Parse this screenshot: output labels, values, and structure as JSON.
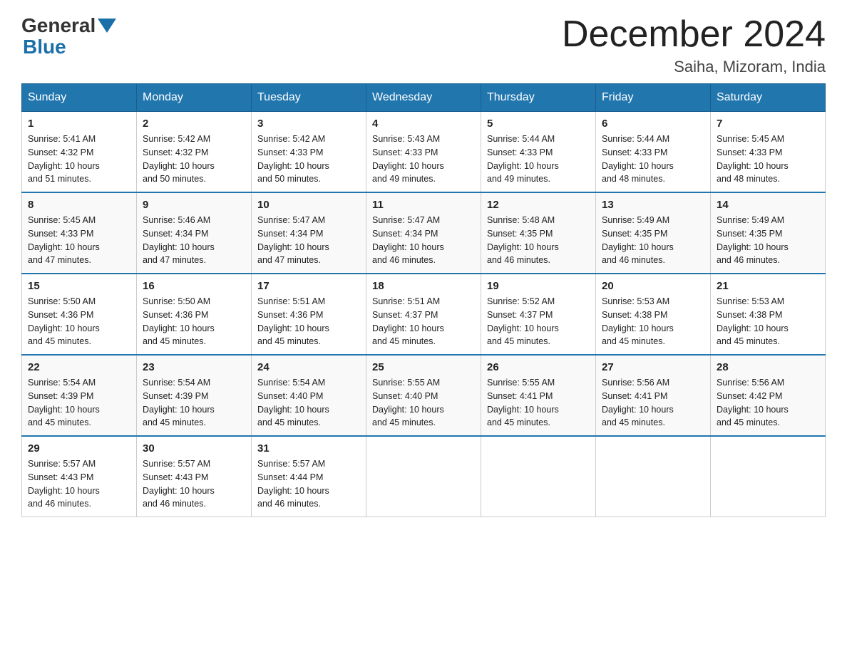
{
  "logo": {
    "text_general": "General",
    "text_blue": "Blue"
  },
  "title": {
    "month_year": "December 2024",
    "location": "Saiha, Mizoram, India"
  },
  "weekdays": [
    "Sunday",
    "Monday",
    "Tuesday",
    "Wednesday",
    "Thursday",
    "Friday",
    "Saturday"
  ],
  "weeks": [
    [
      {
        "day": 1,
        "sunrise": "5:41 AM",
        "sunset": "4:32 PM",
        "daylight": "10 hours and 51 minutes."
      },
      {
        "day": 2,
        "sunrise": "5:42 AM",
        "sunset": "4:32 PM",
        "daylight": "10 hours and 50 minutes."
      },
      {
        "day": 3,
        "sunrise": "5:42 AM",
        "sunset": "4:33 PM",
        "daylight": "10 hours and 50 minutes."
      },
      {
        "day": 4,
        "sunrise": "5:43 AM",
        "sunset": "4:33 PM",
        "daylight": "10 hours and 49 minutes."
      },
      {
        "day": 5,
        "sunrise": "5:44 AM",
        "sunset": "4:33 PM",
        "daylight": "10 hours and 49 minutes."
      },
      {
        "day": 6,
        "sunrise": "5:44 AM",
        "sunset": "4:33 PM",
        "daylight": "10 hours and 48 minutes."
      },
      {
        "day": 7,
        "sunrise": "5:45 AM",
        "sunset": "4:33 PM",
        "daylight": "10 hours and 48 minutes."
      }
    ],
    [
      {
        "day": 8,
        "sunrise": "5:45 AM",
        "sunset": "4:33 PM",
        "daylight": "10 hours and 47 minutes."
      },
      {
        "day": 9,
        "sunrise": "5:46 AM",
        "sunset": "4:34 PM",
        "daylight": "10 hours and 47 minutes."
      },
      {
        "day": 10,
        "sunrise": "5:47 AM",
        "sunset": "4:34 PM",
        "daylight": "10 hours and 47 minutes."
      },
      {
        "day": 11,
        "sunrise": "5:47 AM",
        "sunset": "4:34 PM",
        "daylight": "10 hours and 46 minutes."
      },
      {
        "day": 12,
        "sunrise": "5:48 AM",
        "sunset": "4:35 PM",
        "daylight": "10 hours and 46 minutes."
      },
      {
        "day": 13,
        "sunrise": "5:49 AM",
        "sunset": "4:35 PM",
        "daylight": "10 hours and 46 minutes."
      },
      {
        "day": 14,
        "sunrise": "5:49 AM",
        "sunset": "4:35 PM",
        "daylight": "10 hours and 46 minutes."
      }
    ],
    [
      {
        "day": 15,
        "sunrise": "5:50 AM",
        "sunset": "4:36 PM",
        "daylight": "10 hours and 45 minutes."
      },
      {
        "day": 16,
        "sunrise": "5:50 AM",
        "sunset": "4:36 PM",
        "daylight": "10 hours and 45 minutes."
      },
      {
        "day": 17,
        "sunrise": "5:51 AM",
        "sunset": "4:36 PM",
        "daylight": "10 hours and 45 minutes."
      },
      {
        "day": 18,
        "sunrise": "5:51 AM",
        "sunset": "4:37 PM",
        "daylight": "10 hours and 45 minutes."
      },
      {
        "day": 19,
        "sunrise": "5:52 AM",
        "sunset": "4:37 PM",
        "daylight": "10 hours and 45 minutes."
      },
      {
        "day": 20,
        "sunrise": "5:53 AM",
        "sunset": "4:38 PM",
        "daylight": "10 hours and 45 minutes."
      },
      {
        "day": 21,
        "sunrise": "5:53 AM",
        "sunset": "4:38 PM",
        "daylight": "10 hours and 45 minutes."
      }
    ],
    [
      {
        "day": 22,
        "sunrise": "5:54 AM",
        "sunset": "4:39 PM",
        "daylight": "10 hours and 45 minutes."
      },
      {
        "day": 23,
        "sunrise": "5:54 AM",
        "sunset": "4:39 PM",
        "daylight": "10 hours and 45 minutes."
      },
      {
        "day": 24,
        "sunrise": "5:54 AM",
        "sunset": "4:40 PM",
        "daylight": "10 hours and 45 minutes."
      },
      {
        "day": 25,
        "sunrise": "5:55 AM",
        "sunset": "4:40 PM",
        "daylight": "10 hours and 45 minutes."
      },
      {
        "day": 26,
        "sunrise": "5:55 AM",
        "sunset": "4:41 PM",
        "daylight": "10 hours and 45 minutes."
      },
      {
        "day": 27,
        "sunrise": "5:56 AM",
        "sunset": "4:41 PM",
        "daylight": "10 hours and 45 minutes."
      },
      {
        "day": 28,
        "sunrise": "5:56 AM",
        "sunset": "4:42 PM",
        "daylight": "10 hours and 45 minutes."
      }
    ],
    [
      {
        "day": 29,
        "sunrise": "5:57 AM",
        "sunset": "4:43 PM",
        "daylight": "10 hours and 46 minutes."
      },
      {
        "day": 30,
        "sunrise": "5:57 AM",
        "sunset": "4:43 PM",
        "daylight": "10 hours and 46 minutes."
      },
      {
        "day": 31,
        "sunrise": "5:57 AM",
        "sunset": "4:44 PM",
        "daylight": "10 hours and 46 minutes."
      },
      null,
      null,
      null,
      null
    ]
  ],
  "labels": {
    "sunrise": "Sunrise:",
    "sunset": "Sunset:",
    "daylight": "Daylight:"
  }
}
